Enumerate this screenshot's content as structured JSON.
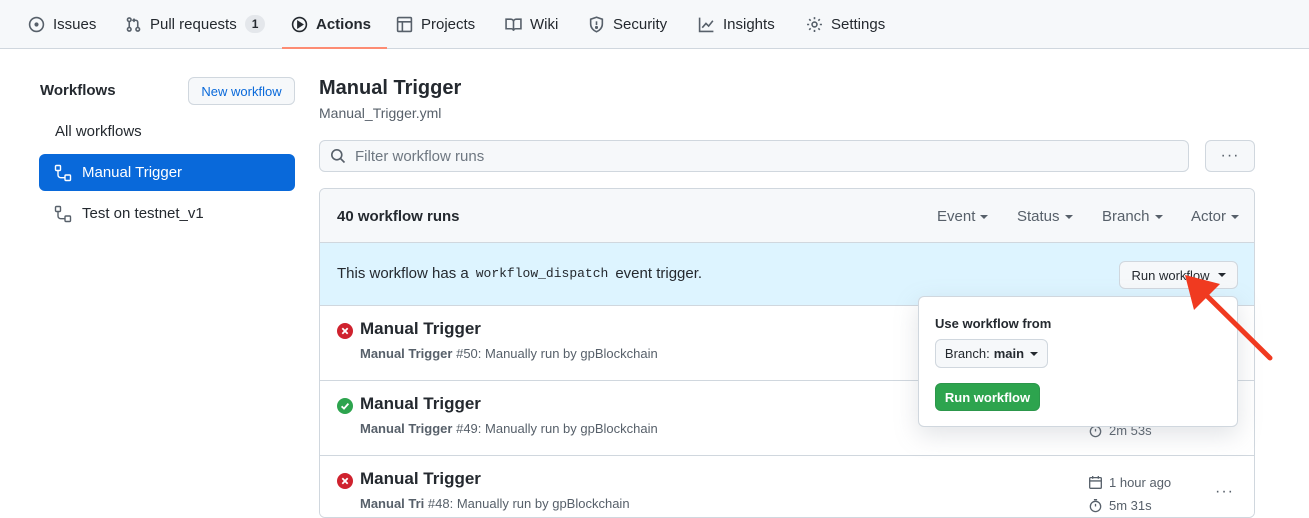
{
  "nav": {
    "tabs": [
      {
        "label": "Issues",
        "icon": "issue-icon"
      },
      {
        "label": "Pull requests",
        "icon": "pull-request-icon",
        "count": "1"
      },
      {
        "label": "Actions",
        "icon": "play-icon",
        "active": true
      },
      {
        "label": "Projects",
        "icon": "table-icon"
      },
      {
        "label": "Wiki",
        "icon": "book-icon"
      },
      {
        "label": "Security",
        "icon": "shield-icon"
      },
      {
        "label": "Insights",
        "icon": "graph-icon"
      },
      {
        "label": "Settings",
        "icon": "gear-icon"
      }
    ]
  },
  "sidebar": {
    "title": "Workflows",
    "new_workflow": "New workflow",
    "items": [
      {
        "label": "All workflows"
      },
      {
        "label": "Manual Trigger",
        "icon": "workflow-icon",
        "active": true
      },
      {
        "label": "Test on testnet_v1",
        "icon": "workflow-icon"
      }
    ]
  },
  "main": {
    "title": "Manual Trigger",
    "file": "Manual_Trigger.yml",
    "filter_placeholder": "Filter workflow runs",
    "more": "···"
  },
  "runs": {
    "count_label": "40 workflow runs",
    "filters": [
      "Event",
      "Status",
      "Branch",
      "Actor"
    ],
    "banner": {
      "prefix": "This workflow has a",
      "code": "workflow_dispatch",
      "suffix": "event trigger.",
      "button": "Run workflow"
    },
    "items": [
      {
        "title": "Manual Trigger",
        "name": "Manual Trigger",
        "detail": "#50: Manually run by gpBlockchain",
        "status": "failure"
      },
      {
        "title": "Manual Trigger",
        "name": "Manual Trigger",
        "detail": "#49: Manually run by gpBlockchain",
        "status": "success",
        "duration": "2m 53s"
      },
      {
        "title": "Manual Trigger",
        "name": "Manual Tri",
        "detail": "#48: Manually run by gpBlockchain",
        "status": "failure",
        "time": "1 hour ago",
        "duration": "5m 31s",
        "more": "···"
      }
    ]
  },
  "popup": {
    "title": "Use workflow from",
    "branch_label": "Branch:",
    "branch_value": "main",
    "run_button": "Run workflow"
  },
  "colors": {
    "accent": "#0969da",
    "success": "#2da44e",
    "failure": "#cf222e",
    "banner": "#ddf4ff",
    "arrow": "#f03a20"
  }
}
